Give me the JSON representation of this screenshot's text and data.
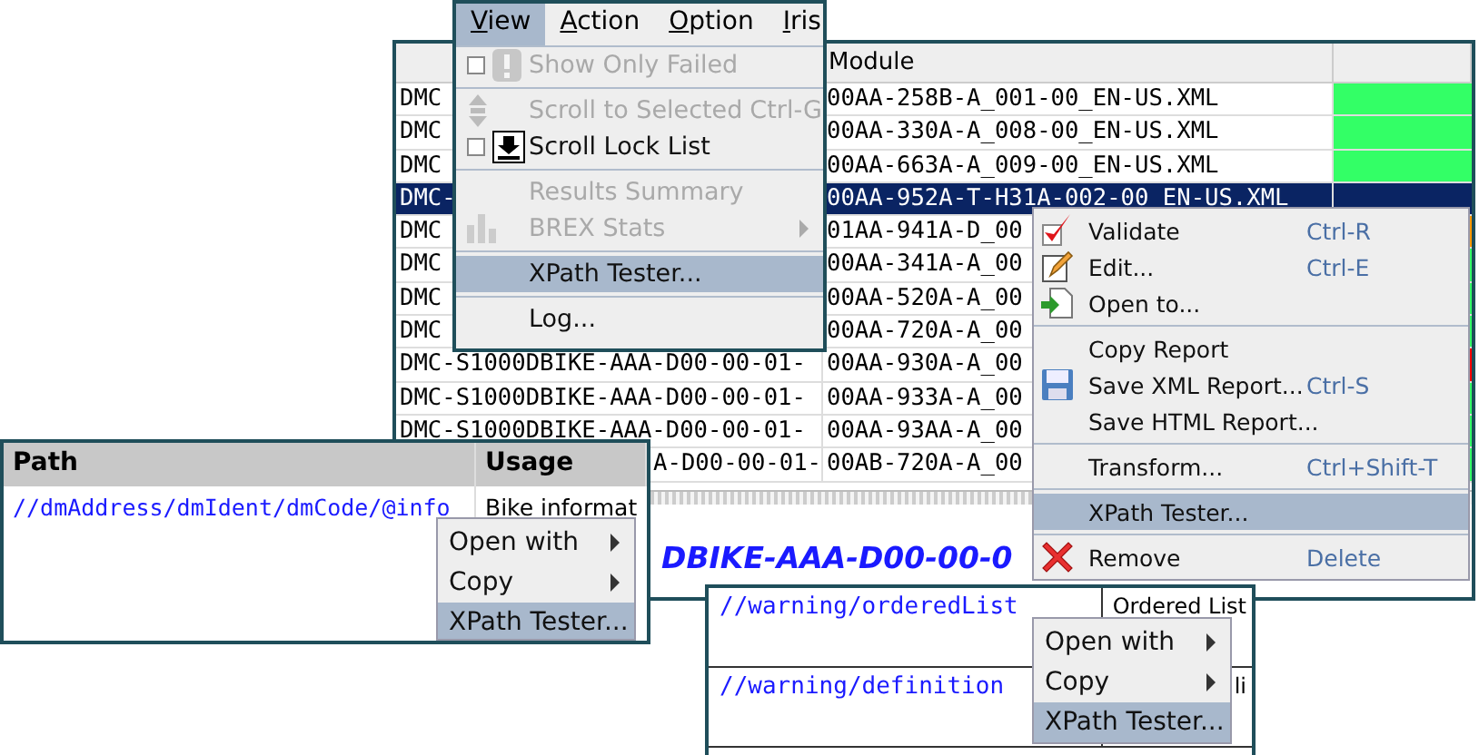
{
  "view_menu": {
    "menubar": [
      {
        "label": "View",
        "selected": true
      },
      {
        "label": "Action",
        "selected": false
      },
      {
        "label": "Option",
        "selected": false
      },
      {
        "label": "Iris",
        "selected": false
      }
    ],
    "items": [
      {
        "kind": "check",
        "label": "Show Only Failed",
        "checked": false,
        "disabled": true,
        "selected": false
      },
      {
        "kind": "separator"
      },
      {
        "kind": "item",
        "label": "Scroll to Selected",
        "shortcut": "Ctrl-G",
        "disabled": true,
        "selected": false
      },
      {
        "kind": "check",
        "label": "Scroll Lock List",
        "checked": false,
        "disabled": false,
        "selected": false
      },
      {
        "kind": "separator"
      },
      {
        "kind": "item",
        "label": "Results Summary",
        "disabled": true,
        "selected": false
      },
      {
        "kind": "item",
        "label": "BREX Stats",
        "disabled": true,
        "selected": false,
        "submenu": true
      },
      {
        "kind": "separator"
      },
      {
        "kind": "item",
        "label": "XPath Tester...",
        "disabled": false,
        "selected": true
      },
      {
        "kind": "separator"
      },
      {
        "kind": "item",
        "label": "Log...",
        "disabled": false,
        "selected": false
      }
    ]
  },
  "results_table": {
    "module_heading": "Module",
    "rows": [
      {
        "kind": "head",
        "code": "DMC",
        "module": "00AA-258B-A_001-00_EN-US.XML",
        "color": "#33ff66",
        "selected": false
      },
      {
        "kind": "head",
        "code": "DMC",
        "module": "00AA-330A-A_008-00_EN-US.XML",
        "color": "#33ff66",
        "selected": false
      },
      {
        "kind": "head",
        "code": "DMC",
        "module": "00AA-663A-A_009-00_EN-US.XML",
        "color": "#33ff66",
        "selected": false
      },
      {
        "kind": "head",
        "code": "DMC-",
        "module": "00AA-952A-T-H31A-002-00_EN-US.XML",
        "color": "#0a2463",
        "selected": true
      },
      {
        "kind": "head",
        "code": "DMC",
        "module": "01AA-941A-D_00",
        "color": "#ff9900",
        "selected": false
      },
      {
        "kind": "head",
        "code": "DMC",
        "module": "00AA-341A-A_00",
        "color": "#33ff66",
        "selected": false
      },
      {
        "kind": "head",
        "code": "DMC",
        "module": "00AA-520A-A_00",
        "color": "#33ff66",
        "selected": false
      },
      {
        "kind": "head",
        "code": "DMC",
        "module": "00AA-720A-A_00",
        "color": "#33ff66",
        "selected": false
      },
      {
        "kind": "head",
        "code": "DMC-S1000DBIKE-AAA-D00-00-01-",
        "module": "00AA-930A-A_00",
        "color": "#ff0000",
        "selected": false
      },
      {
        "kind": "head",
        "code": "DMC-S1000DBIKE-AAA-D00-00-01-",
        "module": "00AA-933A-A_00",
        "color": "#33ff66",
        "selected": false
      },
      {
        "kind": "head",
        "code": "DMC-S1000DBIKE-AAA-D00-00-01-",
        "module": "00AA-93AA-A_00",
        "color": "#33ff66",
        "selected": false
      },
      {
        "kind": "tail",
        "code": "A-D00-00-01-",
        "module": "00AB-720A-A_00",
        "color": "#33ff66",
        "selected": false
      }
    ],
    "title": "DBIKE-AAA-D00-00-0"
  },
  "row_menu": {
    "items": [
      {
        "kind": "item",
        "label": "Validate",
        "shortcut": "Ctrl-R",
        "disabled": false,
        "selected": false
      },
      {
        "kind": "item",
        "label": "Edit...",
        "shortcut": "Ctrl-E",
        "disabled": false,
        "selected": false
      },
      {
        "kind": "item",
        "label": "Open to...",
        "disabled": false,
        "selected": false
      },
      {
        "kind": "separator"
      },
      {
        "kind": "item",
        "label": "Copy Report",
        "disabled": false,
        "selected": false
      },
      {
        "kind": "item",
        "label": "Save XML Report...",
        "shortcut": "Ctrl-S",
        "disabled": false,
        "selected": false
      },
      {
        "kind": "item",
        "label": "Save HTML Report...",
        "disabled": false,
        "selected": false
      },
      {
        "kind": "separator"
      },
      {
        "kind": "item",
        "label": "Transform...",
        "shortcut": "Ctrl+Shift-T",
        "disabled": false,
        "selected": false
      },
      {
        "kind": "separator"
      },
      {
        "kind": "item",
        "label": "XPath Tester...",
        "disabled": false,
        "selected": true
      },
      {
        "kind": "separator"
      },
      {
        "kind": "item",
        "label": "Remove",
        "shortcut": "Delete",
        "disabled": false,
        "selected": false
      }
    ]
  },
  "path_table": {
    "columns": [
      "Path",
      "Usage"
    ],
    "rows": [
      {
        "path": "//dmAddress/dmIdent/dmCode/@info",
        "usage": "Bike informat"
      }
    ]
  },
  "path_menu": {
    "items": [
      {
        "kind": "item",
        "label": "Open with",
        "disabled": false,
        "selected": false,
        "submenu": true
      },
      {
        "kind": "item",
        "label": "Copy",
        "disabled": false,
        "selected": false,
        "submenu": true
      },
      {
        "kind": "item",
        "label": "XPath Tester...",
        "disabled": false,
        "selected": true
      }
    ]
  },
  "warning_table": {
    "rows": [
      {
        "path": "//warning/orderedList",
        "usage": "Ordered List"
      },
      {
        "path": "//warning/definition",
        "usage": "li"
      }
    ]
  },
  "warning_menu": {
    "items": [
      {
        "kind": "item",
        "label": "Open with",
        "disabled": false,
        "selected": false,
        "submenu": true
      },
      {
        "kind": "item",
        "label": "Copy",
        "disabled": false,
        "selected": false,
        "submenu": true
      },
      {
        "kind": "item",
        "label": "XPath Tester...",
        "disabled": false,
        "selected": true
      }
    ]
  }
}
